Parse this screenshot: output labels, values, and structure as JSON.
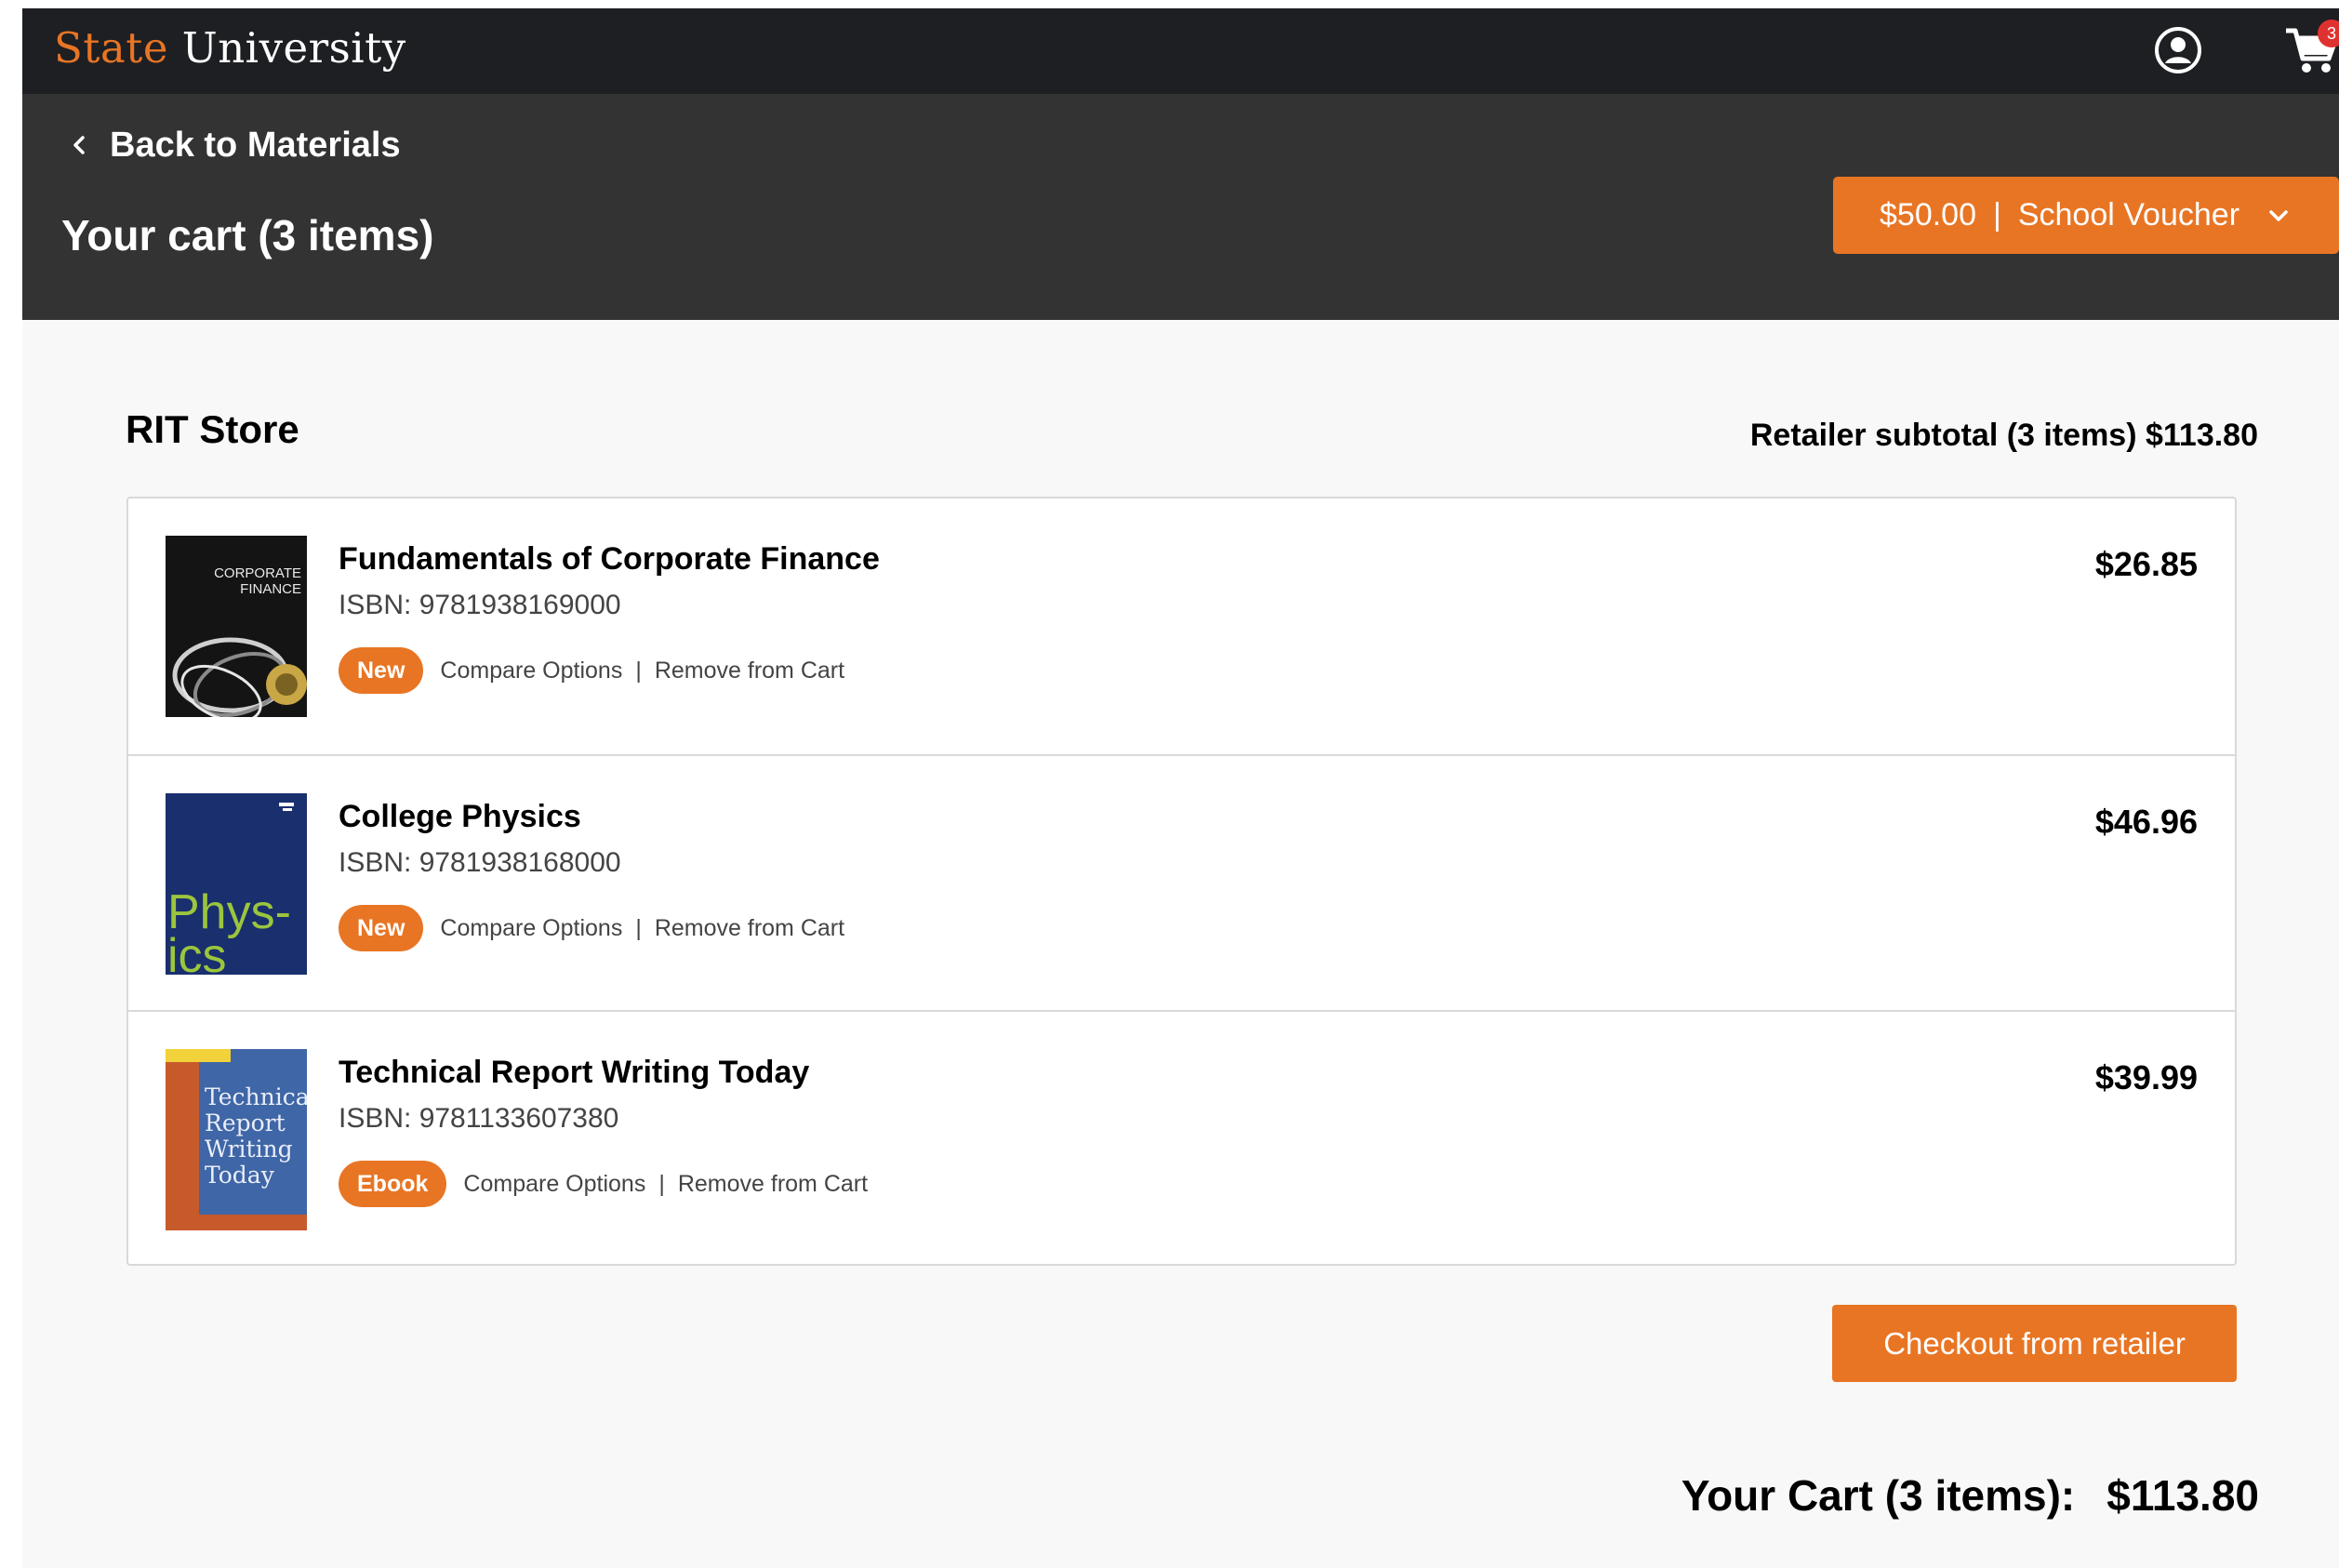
{
  "nav": {
    "brand_accent": "State",
    "brand_rest": " University",
    "cart_count": "3"
  },
  "header": {
    "back_label": "Back to Materials",
    "cart_title": "Your cart (3 items)",
    "voucher_amount": "$50.00",
    "voucher_separator": "|",
    "voucher_label": "School Voucher"
  },
  "store": {
    "name": "RIT Store",
    "subtotal": "Retailer subtotal (3 items) $113.80",
    "items": [
      {
        "title": "Fundamentals of Corporate Finance",
        "isbn": "ISBN: 9781938169000",
        "badge": "New",
        "compare": "Compare Options",
        "remove": "Remove from Cart",
        "price": "$26.85",
        "cover_line1": "CORPORATE",
        "cover_line2": "FINANCE"
      },
      {
        "title": "College Physics",
        "isbn": "ISBN: 9781938168000",
        "badge": "New",
        "compare": "Compare Options",
        "remove": "Remove from Cart",
        "price": "$46.96",
        "cover_line1": "Phys-",
        "cover_line2": "ics"
      },
      {
        "title": "Technical Report Writing Today",
        "isbn": "ISBN: 9781133607380",
        "badge": "Ebook",
        "compare": "Compare Options",
        "remove": "Remove from Cart",
        "price": "$39.99",
        "cover_line1": "Technical",
        "cover_line2": "Report",
        "cover_line3": "Writing",
        "cover_line4": "Today"
      }
    ],
    "checkout_label": "Checkout from retailer"
  },
  "totals": {
    "label": "Your Cart (3 items):",
    "amount": "$113.80"
  },
  "colors": {
    "accent": "#e87524",
    "nav_bg": "#1e1f23",
    "header_bg": "#333333",
    "badge_red": "#e03131"
  },
  "icons": [
    "account-icon",
    "cart-icon",
    "chevron-left-icon",
    "chevron-down-icon"
  ]
}
